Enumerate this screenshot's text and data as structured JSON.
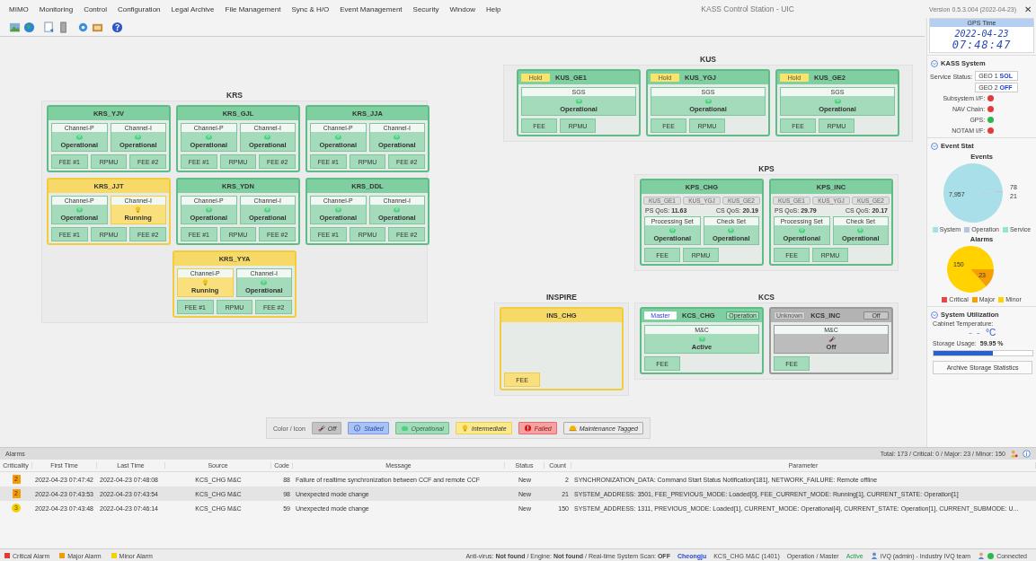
{
  "menu": [
    "MIMO",
    "Monitoring",
    "Control",
    "Configuration",
    "Legal Archive",
    "File Management",
    "Sync & H/O",
    "Event Management",
    "Security",
    "Window",
    "Help"
  ],
  "window": {
    "title": "KASS Control Station - UIC",
    "version": "Version 0.5.3.004 (2022-04-23)",
    "close": "✕"
  },
  "groups": [
    {
      "title": "KRS",
      "rows": [
        [
          {
            "name": "KRS_YJV",
            "kind": "operational",
            "units": [
              {
                "label": "Channel-P",
                "status": "Operational",
                "kind": "operational"
              },
              {
                "label": "Channel-I",
                "status": "Operational",
                "kind": "operational"
              }
            ],
            "modules": [
              {
                "label": "FEE #1",
                "kind": "operational"
              },
              {
                "label": "RPMU",
                "kind": "operational"
              },
              {
                "label": "FEE #2",
                "kind": "operational"
              }
            ]
          },
          {
            "name": "KRS_GJL",
            "kind": "operational",
            "units": [
              {
                "label": "Channel-P",
                "status": "Operational",
                "kind": "operational"
              },
              {
                "label": "Channel-I",
                "status": "Operational",
                "kind": "operational"
              }
            ],
            "modules": [
              {
                "label": "FEE #1",
                "kind": "operational"
              },
              {
                "label": "RPMU",
                "kind": "operational"
              },
              {
                "label": "FEE #2",
                "kind": "operational"
              }
            ]
          },
          {
            "name": "KRS_JJA",
            "kind": "operational",
            "units": [
              {
                "label": "Channel-P",
                "status": "Operational",
                "kind": "operational"
              },
              {
                "label": "Channel-I",
                "status": "Operational",
                "kind": "operational"
              }
            ],
            "modules": [
              {
                "label": "FEE #1",
                "kind": "operational"
              },
              {
                "label": "RPMU",
                "kind": "operational"
              },
              {
                "label": "FEE #2",
                "kind": "operational"
              }
            ]
          }
        ],
        [
          {
            "name": "KRS_JJT",
            "kind": "intermediate",
            "units": [
              {
                "label": "Channel-P",
                "status": "Operational",
                "kind": "operational"
              },
              {
                "label": "Channel-I",
                "status": "Running",
                "kind": "intermediate"
              }
            ],
            "modules": [
              {
                "label": "FEE #1",
                "kind": "operational"
              },
              {
                "label": "RPMU",
                "kind": "operational"
              },
              {
                "label": "FEE #2",
                "kind": "operational"
              }
            ]
          },
          {
            "name": "KRS_YDN",
            "kind": "operational",
            "units": [
              {
                "label": "Channel-P",
                "status": "Operational",
                "kind": "operational"
              },
              {
                "label": "Channel-I",
                "status": "Operational",
                "kind": "operational"
              }
            ],
            "modules": [
              {
                "label": "FEE #1",
                "kind": "operational"
              },
              {
                "label": "RPMU",
                "kind": "operational"
              },
              {
                "label": "FEE #2",
                "kind": "operational"
              }
            ]
          },
          {
            "name": "KRS_DDL",
            "kind": "operational",
            "units": [
              {
                "label": "Channel-P",
                "status": "Operational",
                "kind": "operational"
              },
              {
                "label": "Channel-I",
                "status": "Operational",
                "kind": "operational"
              }
            ],
            "modules": [
              {
                "label": "FEE #1",
                "kind": "operational"
              },
              {
                "label": "RPMU",
                "kind": "operational"
              },
              {
                "label": "FEE #2",
                "kind": "operational"
              }
            ]
          }
        ],
        [
          "",
          {
            "name": "KRS_YYA",
            "kind": "intermediate",
            "units": [
              {
                "label": "Channel-P",
                "status": "Running",
                "kind": "intermediate"
              },
              {
                "label": "Channel-I",
                "status": "Operational",
                "kind": "operational"
              }
            ],
            "modules": [
              {
                "label": "FEE #1",
                "kind": "operational"
              },
              {
                "label": "RPMU",
                "kind": "operational"
              },
              {
                "label": "FEE #2",
                "kind": "operational"
              }
            ]
          }
        ]
      ]
    },
    {
      "title": "KUS",
      "rows": [
        [
          {
            "name": "KUS_GE1",
            "kind": "operational",
            "left_tag": {
              "label": "Hold",
              "kind": "hold"
            },
            "units": [
              {
                "label": "SGS",
                "status": "Operational",
                "kind": "operational"
              }
            ],
            "modules": [
              {
                "label": "FEE",
                "kind": "operational"
              },
              {
                "label": "RPMU",
                "kind": "operational"
              }
            ]
          },
          {
            "name": "KUS_YGJ",
            "kind": "operational",
            "left_tag": {
              "label": "Hold",
              "kind": "hold"
            },
            "units": [
              {
                "label": "SGS",
                "status": "Operational",
                "kind": "operational"
              }
            ],
            "modules": [
              {
                "label": "FEE",
                "kind": "operational"
              },
              {
                "label": "RPMU",
                "kind": "operational"
              }
            ]
          },
          {
            "name": "KUS_GE2",
            "kind": "operational",
            "left_tag": {
              "label": "Hold",
              "kind": "hold"
            },
            "units": [
              {
                "label": "SGS",
                "status": "Operational",
                "kind": "operational"
              }
            ],
            "modules": [
              {
                "label": "FEE",
                "kind": "operational"
              },
              {
                "label": "RPMU",
                "kind": "operational"
              }
            ]
          }
        ]
      ]
    },
    {
      "title": "KPS",
      "rows": [
        [
          {
            "name": "KPS_CHG",
            "kind": "operational",
            "links": [
              {
                "label": "KUS_GE1",
                "disabled": true
              },
              {
                "label": "KUS_YGJ",
                "disabled": true
              },
              {
                "label": "KUS_GE2",
                "disabled": true
              }
            ],
            "qos": [
              "PS QoS: **11.63**",
              "CS QoS: **20.19**"
            ],
            "units": [
              {
                "label": "Processing Set",
                "status": "Operational",
                "kind": "operational"
              },
              {
                "label": "Check Set",
                "status": "Operational",
                "kind": "operational"
              }
            ],
            "modules": [
              {
                "label": "FEE",
                "kind": "operational"
              },
              {
                "label": "RPMU",
                "kind": "operational"
              }
            ]
          },
          {
            "name": "KPS_INC",
            "kind": "operational",
            "links": [
              {
                "label": "KUS_GE1",
                "disabled": true
              },
              {
                "label": "KUS_YGJ",
                "disabled": true
              },
              {
                "label": "KUS_GE2",
                "disabled": true
              }
            ],
            "qos": [
              "PS QoS: **29.79**",
              "CS QoS: **20.17**"
            ],
            "units": [
              {
                "label": "Processing Set",
                "status": "Operational",
                "kind": "operational"
              },
              {
                "label": "Check Set",
                "status": "Operational",
                "kind": "operational"
              }
            ],
            "modules": [
              {
                "label": "FEE",
                "kind": "operational"
              },
              {
                "label": "RPMU",
                "kind": "operational"
              }
            ]
          }
        ]
      ]
    },
    {
      "title": "INSPIRE",
      "rows": [
        [
          {
            "name": "INS_CHG",
            "kind": "intermediate",
            "modules": [
              {
                "label": "FEE",
                "kind": "intermediate"
              }
            ]
          }
        ]
      ]
    },
    {
      "title": "KCS",
      "rows": [
        [
          {
            "name": "KCS_CHG",
            "kind": "operational",
            "left_tag": {
              "label": "Master",
              "kind": "master"
            },
            "right_tag": {
              "label": "Operation",
              "kind": "mode"
            },
            "units": [
              {
                "label": "M&C",
                "status": "Active",
                "kind": "operational"
              }
            ],
            "modules": [
              {
                "label": "FEE",
                "kind": "operational"
              }
            ]
          },
          {
            "name": "KCS_INC",
            "kind": "off",
            "left_tag": {
              "label": "Unknown",
              "kind": "unknown"
            },
            "right_tag": {
              "label": "Off",
              "kind": "plain"
            },
            "units": [
              {
                "label": "M&C",
                "status": "Off",
                "kind": "off"
              }
            ],
            "modules": [
              {
                "label": "FEE",
                "kind": "operational"
              }
            ]
          }
        ]
      ]
    }
  ],
  "legend": {
    "title": "Color / Icon",
    "items": [
      {
        "label": "Off",
        "kind": "off"
      },
      {
        "label": "Stalled",
        "kind": "stalled"
      },
      {
        "label": "Operational",
        "kind": "operational"
      },
      {
        "label": "Intermediate",
        "kind": "intermediate"
      },
      {
        "label": "Failed",
        "kind": "failed"
      },
      {
        "label": "Maintenance Tagged",
        "kind": "maintenance"
      }
    ]
  },
  "side": {
    "gps": {
      "title": "GPS Time",
      "date": "2022-04-23",
      "time": "07:48:47"
    },
    "kass": {
      "title": "KASS System",
      "service_label": "Service Status:",
      "geo": [
        "GEO 1 **SOL**",
        "GEO 2 **OFF**"
      ],
      "indicators": [
        {
          "label": "Subsystem I/F:",
          "color": "#e23b3b"
        },
        {
          "label": "NAV Chain:",
          "color": "#e23b3b"
        },
        {
          "label": "GPS:",
          "color": "#2fb84a"
        },
        {
          "label": "NOTAM I/F:",
          "color": "#e23b3b"
        }
      ]
    },
    "event_stat": {
      "title": "Event Stat",
      "charts": [
        {
          "chart_data": {
            "type": "pie",
            "title": "Events",
            "categories": [
              "System",
              "Operation",
              "Service"
            ],
            "values": [
              7957,
              78,
              21
            ],
            "colors": [
              "#a9dfe8",
              "#b7c4dc",
              "#8be9d2"
            ],
            "value_labels": [
              "7,957",
              "78",
              "21"
            ],
            "legend": "bottom"
          }
        },
        {
          "chart_data": {
            "type": "pie",
            "title": "Alarms",
            "categories": [
              "Critical",
              "Major",
              "Minor"
            ],
            "values": [
              0,
              23,
              150
            ],
            "colors": [
              "#e84545",
              "#f5a000",
              "#ffd200"
            ],
            "data_labels": true,
            "legend": "bottom"
          }
        }
      ]
    },
    "utilization": {
      "title": "System Utilization",
      "temp_label": "Cabinet Temperature:",
      "temp": "--",
      "temp_unit": "°C",
      "storage_label": "Storage Usage:",
      "storage_value": "59.95 %",
      "level": 0.5995,
      "button": "Archive Storage Statistics"
    }
  },
  "alarms": {
    "title": "Alarms",
    "summary": "Total: 173 / Critical: 0 / Major: 23 / Minor: 150",
    "columns": [
      "Criticality",
      "First Time",
      "Last Time",
      "Source",
      "Code",
      "Message",
      "Status",
      "Count",
      "Parameter"
    ],
    "rows": [
      {
        "kind": "major",
        "criticality": "2",
        "first": "2022-04-23 07:47:42",
        "last": "2022-04-23 07:48:08",
        "source": "KCS_CHG M&C",
        "code": "88",
        "message": "Failure of realtime synchronization between CCF and remote CCF",
        "status": "New",
        "count": "2",
        "parameter": "SYNCHRONIZATION_DATA: Command Start Status Notification[181], NETWORK_FAILURE: Remote offline",
        "selected": false
      },
      {
        "kind": "major",
        "criticality": "2",
        "first": "2022-04-23 07:43:53",
        "last": "2022-04-23 07:43:54",
        "source": "KCS_CHG M&C",
        "code": "98",
        "message": "Unexpected mode change",
        "status": "New",
        "count": "21",
        "parameter": "SYSTEM_ADDRESS: 3501, FEE_PREVIOUS_MODE: Loaded[0], FEE_CURRENT_MODE: Running[1], CURRENT_STATE: Operation[1]",
        "selected": true
      },
      {
        "kind": "minor",
        "criticality": "3",
        "first": "2022-04-23 07:43:48",
        "last": "2022-04-23 07:46:14",
        "source": "KCS_CHG M&C",
        "code": "59",
        "message": "Unexpected mode change",
        "status": "New",
        "count": "150",
        "parameter": "SYSTEM_ADDRESS: 1311, PREVIOUS_MODE: Loaded[1], CURRENT_MODE: Operational[4], CURRENT_STATE: Operation[1], CURRENT_SUBMODE: U...",
        "selected": false
      }
    ]
  },
  "status_bar": {
    "legend": [
      {
        "label": "Critical Alarm",
        "color": "#e53935"
      },
      {
        "label": "Major Alarm",
        "color": "#f29b0b"
      },
      {
        "label": "Minor Alarm",
        "color": "#f7d000"
      }
    ],
    "security": "Anti-virus: **Not found** / Engine: **Not found** / Real-time System Scan: **OFF**",
    "site": "Cheongju",
    "node": "KCS_CHG M&C (1401)",
    "mode": "Operation / Master",
    "state": "Active",
    "user": "IVQ (admin) - Industry IVQ team",
    "connection": "Connected"
  }
}
